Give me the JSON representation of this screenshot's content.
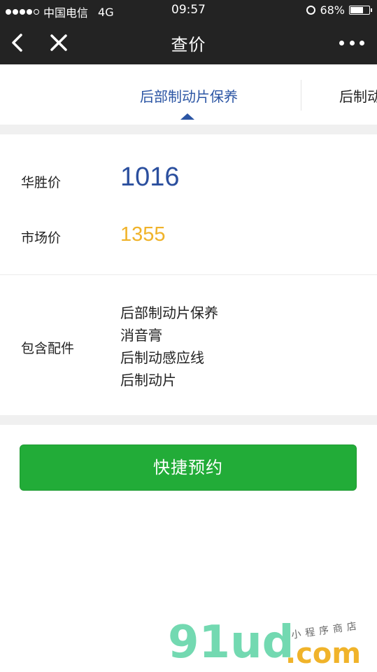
{
  "status_bar": {
    "carrier": "中国电信",
    "network": "4G",
    "time": "09:57",
    "battery": "68%",
    "battery_level": 0.68
  },
  "nav": {
    "title": "查价",
    "back_icon": "back-arrow-icon",
    "close_icon": "close-icon",
    "more_icon": "more-dots-icon"
  },
  "tabs": {
    "active": "后部制动片保养",
    "next": "后制动"
  },
  "prices": {
    "huasheng_label": "华胜价",
    "huasheng_value": "1016",
    "market_label": "市场价",
    "market_value": "1355"
  },
  "parts": {
    "label": "包含配件",
    "items": [
      "后部制动片保养",
      "消音膏",
      "后制动感应线",
      "后制动片"
    ]
  },
  "actions": {
    "book_label": "快捷预约"
  },
  "watermark": {
    "main": "91ud",
    "domain": ".com",
    "subtitle": "小程序商店"
  },
  "colors": {
    "nav_bg": "#232323",
    "accent_blue": "#2b55a4",
    "market_yellow": "#f0b32a",
    "button_green": "#22ac38"
  }
}
